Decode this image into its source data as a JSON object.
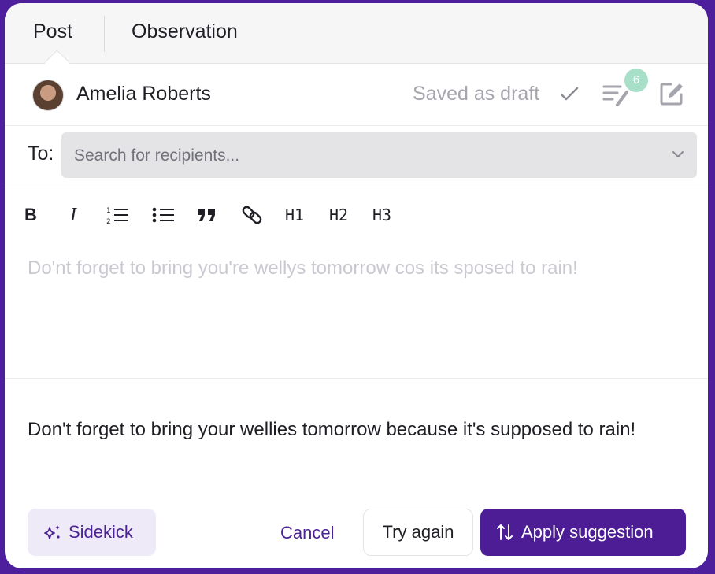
{
  "tabs": [
    {
      "label": "Post",
      "active": true
    },
    {
      "label": "Observation",
      "active": false
    }
  ],
  "header": {
    "user_name": "Amelia Roberts",
    "status": "Saved as draft",
    "suggestion_count": "6"
  },
  "recipients": {
    "label": "To:",
    "placeholder": "Search for recipients..."
  },
  "toolbar": {
    "h1": "H1",
    "h2": "H2",
    "h3": "H3"
  },
  "editor": {
    "text": "Do'nt forget to bring you're wellys tomorrow cos its sposed to rain!"
  },
  "suggestion": {
    "text": "Don't forget to bring your wellies tomorrow because it's supposed to rain!"
  },
  "footer": {
    "sidekick_label": "Sidekick",
    "cancel_label": "Cancel",
    "try_again_label": "Try again",
    "apply_label": "Apply suggestion"
  },
  "colors": {
    "accent": "#4c1d95",
    "badge": "#a8dfc8",
    "frame": "#4e1f9c"
  },
  "icons": [
    "check-icon",
    "suggestion-list-icon",
    "edit-icon",
    "chevron-down-icon",
    "bold-icon",
    "italic-icon",
    "ordered-list-icon",
    "bullet-list-icon",
    "quote-icon",
    "link-icon",
    "sparkle-icon",
    "swap-icon"
  ]
}
